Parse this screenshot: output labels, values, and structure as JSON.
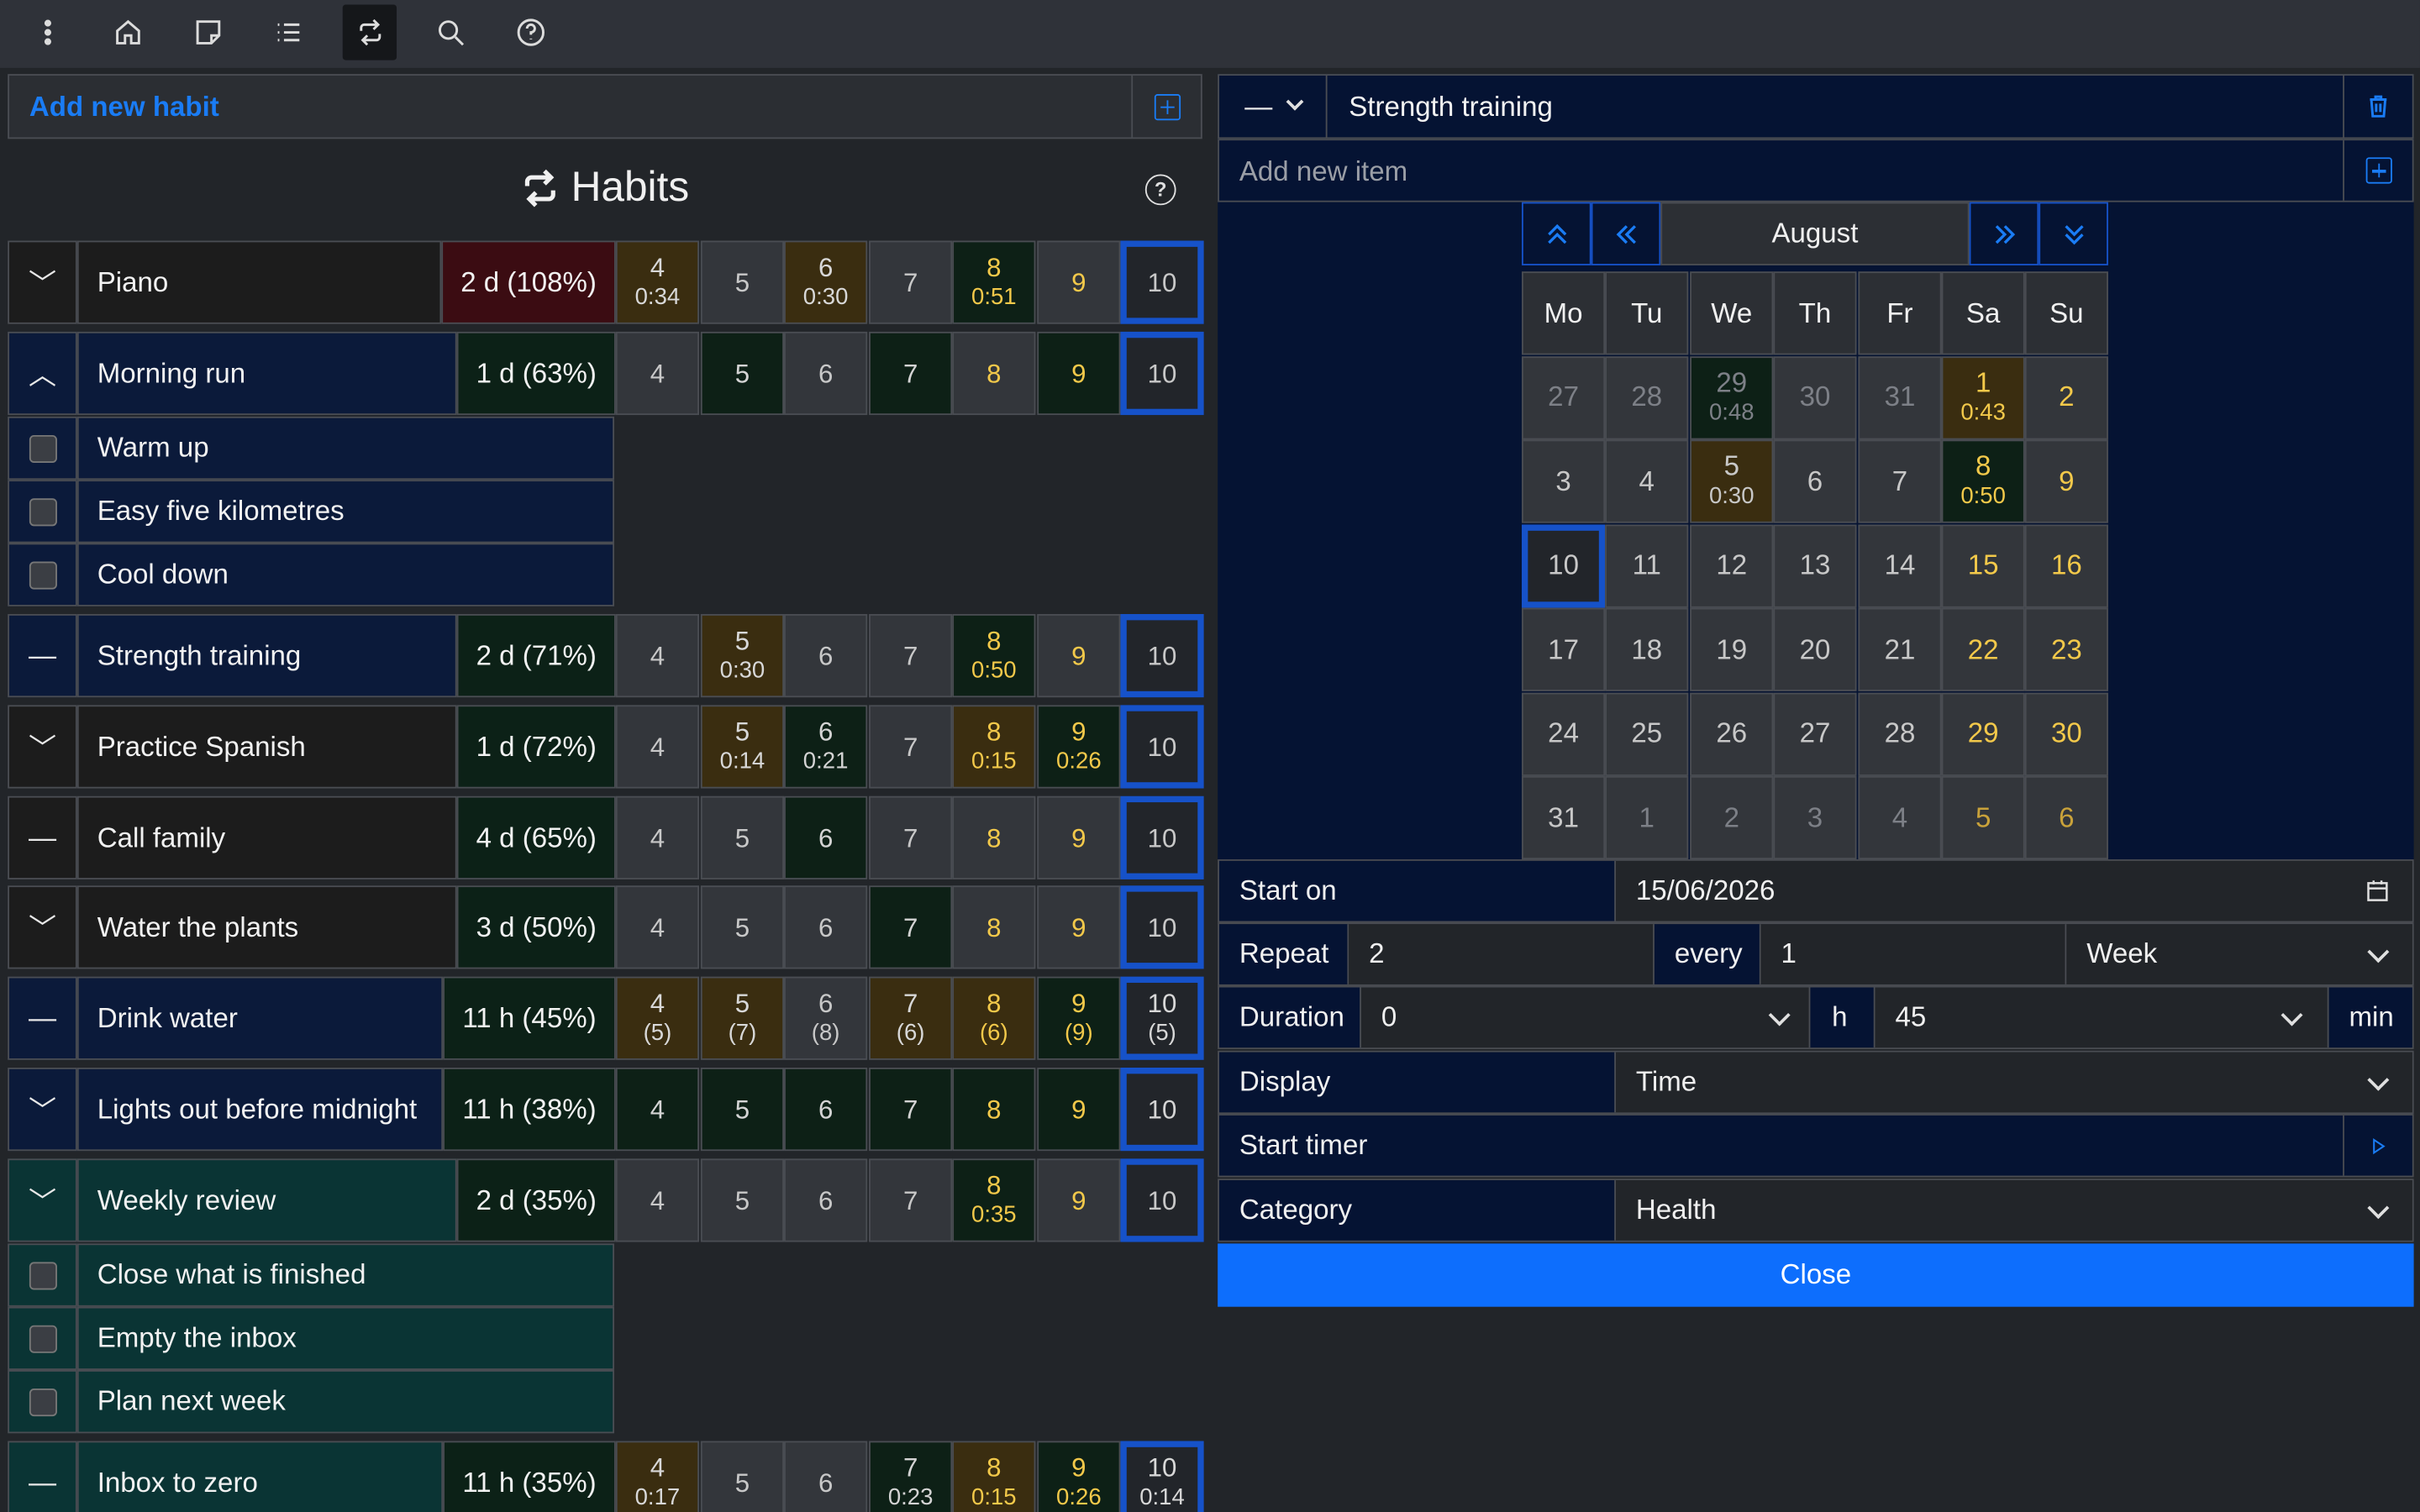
{
  "toolbar": {
    "icons": [
      "menu-dots-icon",
      "home-icon",
      "note-icon",
      "list-icon",
      "repeat-icon",
      "search-icon",
      "help-icon"
    ],
    "active": "repeat-icon"
  },
  "left": {
    "add_habit_label": "Add new habit",
    "title": "Habits"
  },
  "habits": [
    {
      "toggle": "﹀",
      "name": "Piano",
      "streak": "2 d (108%)",
      "days": [
        {
          "n": "4",
          "s": "0:34"
        },
        {
          "n": "5",
          "s": ""
        },
        {
          "n": "6",
          "s": "0:30"
        },
        {
          "n": "7",
          "s": ""
        },
        {
          "n": "8",
          "s": "0:51"
        },
        {
          "n": "9",
          "s": ""
        },
        {
          "n": "10",
          "s": ""
        }
      ]
    },
    {
      "toggle": "︿",
      "name": "Morning run",
      "streak": "1 d (63%)",
      "days": [
        {
          "n": "4",
          "s": ""
        },
        {
          "n": "5",
          "s": ""
        },
        {
          "n": "6",
          "s": ""
        },
        {
          "n": "7",
          "s": ""
        },
        {
          "n": "8",
          "s": ""
        },
        {
          "n": "9",
          "s": ""
        },
        {
          "n": "10",
          "s": ""
        }
      ],
      "items": [
        "Warm up",
        "Easy five kilometres",
        "Cool down"
      ]
    },
    {
      "toggle": "—",
      "name": "Strength training",
      "streak": "2 d (71%)",
      "days": [
        {
          "n": "4",
          "s": ""
        },
        {
          "n": "5",
          "s": "0:30"
        },
        {
          "n": "6",
          "s": ""
        },
        {
          "n": "7",
          "s": ""
        },
        {
          "n": "8",
          "s": "0:50"
        },
        {
          "n": "9",
          "s": ""
        },
        {
          "n": "10",
          "s": ""
        }
      ]
    },
    {
      "toggle": "﹀",
      "name": "Practice Spanish",
      "streak": "1 d (72%)",
      "days": [
        {
          "n": "4",
          "s": ""
        },
        {
          "n": "5",
          "s": "0:14"
        },
        {
          "n": "6",
          "s": "0:21"
        },
        {
          "n": "7",
          "s": ""
        },
        {
          "n": "8",
          "s": "0:15"
        },
        {
          "n": "9",
          "s": "0:26"
        },
        {
          "n": "10",
          "s": ""
        }
      ]
    },
    {
      "toggle": "—",
      "name": "Call family",
      "streak": "4 d (65%)",
      "days": [
        {
          "n": "4",
          "s": ""
        },
        {
          "n": "5",
          "s": ""
        },
        {
          "n": "6",
          "s": ""
        },
        {
          "n": "7",
          "s": ""
        },
        {
          "n": "8",
          "s": ""
        },
        {
          "n": "9",
          "s": ""
        },
        {
          "n": "10",
          "s": ""
        }
      ]
    },
    {
      "toggle": "﹀",
      "name": "Water the plants",
      "streak": "3 d (50%)",
      "days": [
        {
          "n": "4",
          "s": ""
        },
        {
          "n": "5",
          "s": ""
        },
        {
          "n": "6",
          "s": ""
        },
        {
          "n": "7",
          "s": ""
        },
        {
          "n": "8",
          "s": ""
        },
        {
          "n": "9",
          "s": ""
        },
        {
          "n": "10",
          "s": ""
        }
      ]
    },
    {
      "toggle": "—",
      "name": "Drink water",
      "streak": "11 h (45%)",
      "days": [
        {
          "n": "4",
          "s": "(5)"
        },
        {
          "n": "5",
          "s": "(7)"
        },
        {
          "n": "6",
          "s": "(8)"
        },
        {
          "n": "7",
          "s": "(6)"
        },
        {
          "n": "8",
          "s": "(6)"
        },
        {
          "n": "9",
          "s": "(9)"
        },
        {
          "n": "10",
          "s": "(5)"
        }
      ]
    },
    {
      "toggle": "﹀",
      "name": "Lights out before midnight",
      "streak": "11 h (38%)",
      "days": [
        {
          "n": "4",
          "s": ""
        },
        {
          "n": "5",
          "s": ""
        },
        {
          "n": "6",
          "s": ""
        },
        {
          "n": "7",
          "s": ""
        },
        {
          "n": "8",
          "s": ""
        },
        {
          "n": "9",
          "s": ""
        },
        {
          "n": "10",
          "s": ""
        }
      ]
    },
    {
      "toggle": "﹀",
      "name": "Weekly review",
      "streak": "2 d (35%)",
      "days": [
        {
          "n": "4",
          "s": ""
        },
        {
          "n": "5",
          "s": ""
        },
        {
          "n": "6",
          "s": ""
        },
        {
          "n": "7",
          "s": ""
        },
        {
          "n": "8",
          "s": "0:35"
        },
        {
          "n": "9",
          "s": ""
        },
        {
          "n": "10",
          "s": ""
        }
      ],
      "items": [
        "Close what is finished",
        "Empty the inbox",
        "Plan next week"
      ]
    },
    {
      "toggle": "—",
      "name": "Inbox to zero",
      "streak": "11 h (35%)",
      "days": [
        {
          "n": "4",
          "s": "0:17"
        },
        {
          "n": "5",
          "s": ""
        },
        {
          "n": "6",
          "s": ""
        },
        {
          "n": "7",
          "s": "0:23"
        },
        {
          "n": "8",
          "s": "0:15"
        },
        {
          "n": "9",
          "s": "0:26"
        },
        {
          "n": "10",
          "s": "0:14"
        }
      ]
    }
  ],
  "editor": {
    "header_select": "—",
    "title": "Strength training",
    "add_item_placeholder": "Add new item",
    "month": "August",
    "weekdays": [
      "Mo",
      "Tu",
      "We",
      "Th",
      "Fr",
      "Sa",
      "Su"
    ],
    "weeks": [
      [
        {
          "n": "27",
          "s": ""
        },
        {
          "n": "28",
          "s": ""
        },
        {
          "n": "29",
          "s": "0:48"
        },
        {
          "n": "30",
          "s": ""
        },
        {
          "n": "31",
          "s": ""
        },
        {
          "n": "1",
          "s": "0:43"
        },
        {
          "n": "2",
          "s": ""
        }
      ],
      [
        {
          "n": "3",
          "s": ""
        },
        {
          "n": "4",
          "s": ""
        },
        {
          "n": "5",
          "s": "0:30"
        },
        {
          "n": "6",
          "s": ""
        },
        {
          "n": "7",
          "s": ""
        },
        {
          "n": "8",
          "s": "0:50"
        },
        {
          "n": "9",
          "s": ""
        }
      ],
      [
        {
          "n": "10",
          "s": ""
        },
        {
          "n": "11",
          "s": ""
        },
        {
          "n": "12",
          "s": ""
        },
        {
          "n": "13",
          "s": ""
        },
        {
          "n": "14",
          "s": ""
        },
        {
          "n": "15",
          "s": ""
        },
        {
          "n": "16",
          "s": ""
        }
      ],
      [
        {
          "n": "17",
          "s": ""
        },
        {
          "n": "18",
          "s": ""
        },
        {
          "n": "19",
          "s": ""
        },
        {
          "n": "20",
          "s": ""
        },
        {
          "n": "21",
          "s": ""
        },
        {
          "n": "22",
          "s": ""
        },
        {
          "n": "23",
          "s": ""
        }
      ],
      [
        {
          "n": "24",
          "s": ""
        },
        {
          "n": "25",
          "s": ""
        },
        {
          "n": "26",
          "s": ""
        },
        {
          "n": "27",
          "s": ""
        },
        {
          "n": "28",
          "s": ""
        },
        {
          "n": "29",
          "s": ""
        },
        {
          "n": "30",
          "s": ""
        }
      ],
      [
        {
          "n": "31",
          "s": ""
        },
        {
          "n": "1",
          "s": ""
        },
        {
          "n": "2",
          "s": ""
        },
        {
          "n": "3",
          "s": ""
        },
        {
          "n": "4",
          "s": ""
        },
        {
          "n": "5",
          "s": ""
        },
        {
          "n": "6",
          "s": ""
        }
      ]
    ],
    "start_on_label": "Start on",
    "start_on_value": "15/06/2026",
    "repeat_label": "Repeat",
    "repeat_value": "2",
    "every_label": "every",
    "every_value": "1",
    "period_value": "Week",
    "duration_label": "Duration",
    "hours_value": "0",
    "h_label": "h",
    "minutes_value": "45",
    "min_label": "min",
    "display_label": "Display",
    "display_value": "Time",
    "start_timer_label": "Start timer",
    "category_label": "Category",
    "category_value": "Health",
    "close_label": "Close"
  },
  "colors": {
    "accent": "#1a7cf5",
    "close_button": "#0d6efd",
    "weekend_text": "#f3c94a",
    "done_green": "#0d2016",
    "timed_ochre": "#3a2d10",
    "today_border": "#1652c9"
  }
}
